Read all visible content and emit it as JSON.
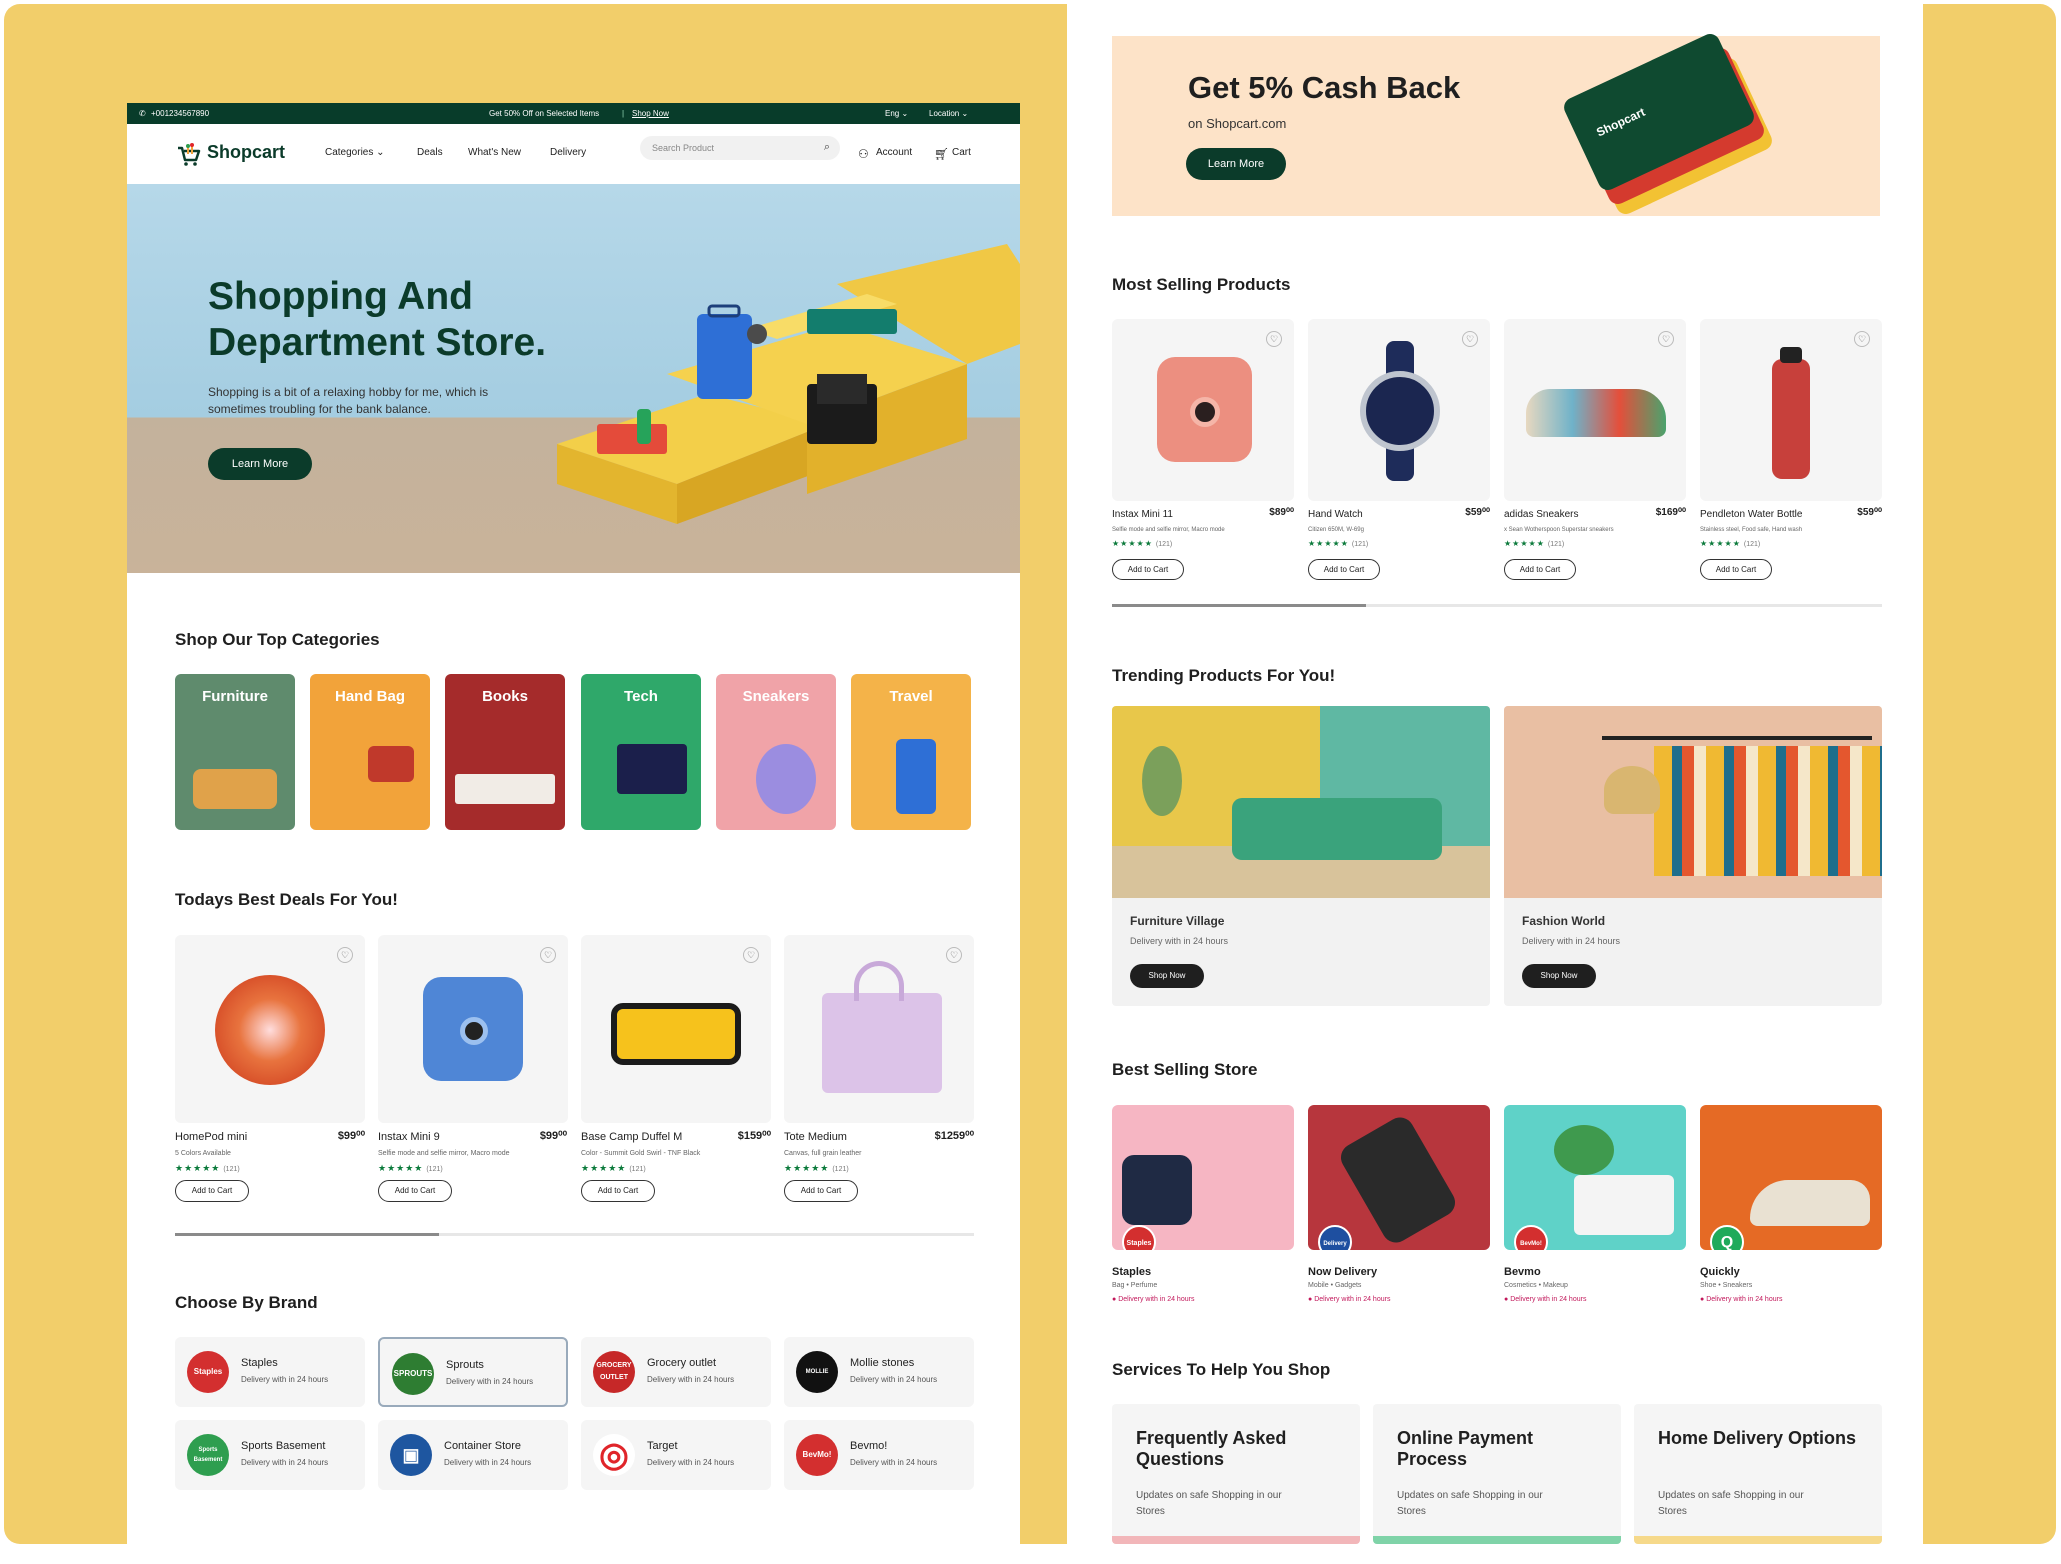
{
  "topbar": {
    "phone": "+001234567890",
    "promo": "Get 50% Off on Selected Items",
    "shop_now": "Shop Now",
    "lang": "Eng ⌄",
    "location": "Location ⌄"
  },
  "nav": {
    "logo": "Shopcart",
    "categories": "Categories ⌄",
    "deals": "Deals",
    "whats_new": "What's New",
    "delivery": "Delivery",
    "search_placeholder": "Search Product",
    "account": "Account",
    "cart": "Cart"
  },
  "hero": {
    "title": "Shopping And Department Store.",
    "subtitle": "Shopping is a bit of a relaxing hobby for me, which is sometimes troubling for the bank balance.",
    "cta": "Learn More"
  },
  "categories": {
    "title": "Shop Our Top Categories",
    "items": [
      {
        "label": "Furniture",
        "color": "#5f8b6d"
      },
      {
        "label": "Hand Bag",
        "color": "#f2a33a"
      },
      {
        "label": "Books",
        "color": "#a52b2b"
      },
      {
        "label": "Tech",
        "color": "#2fa86a"
      },
      {
        "label": "Sneakers",
        "color": "#f0a3a8"
      },
      {
        "label": "Travel",
        "color": "#f4b349"
      }
    ]
  },
  "deals": {
    "title": "Todays Best Deals For You!",
    "add_label": "Add to Cart",
    "items": [
      {
        "name": "HomePod mini",
        "price": "$99⁰⁰",
        "desc": "5 Colors Available",
        "rating": "★★★★★",
        "reviews": "(121)"
      },
      {
        "name": "Instax Mini 9",
        "price": "$99⁰⁰",
        "desc": "Selfie mode and selfie mirror, Macro mode",
        "rating": "★★★★★",
        "reviews": "(121)"
      },
      {
        "name": "Base Camp Duffel M",
        "price": "$159⁰⁰",
        "desc": "Color - Summit Gold Swirl - TNF Black",
        "rating": "★★★★★",
        "reviews": "(121)"
      },
      {
        "name": "Tote Medium",
        "price": "$1259⁰⁰",
        "desc": "Canvas, full grain leather",
        "rating": "★★★★★",
        "reviews": "(121)"
      }
    ],
    "scroll_progress": 0.33
  },
  "brands": {
    "title": "Choose By Brand",
    "items": [
      {
        "name": "Staples",
        "delivery": "Delivery with in 24 hours",
        "logo": "Staples",
        "color": "#d32f2f"
      },
      {
        "name": "Sprouts",
        "delivery": "Delivery with in 24 hours",
        "logo": "SPROUTS",
        "color": "#2e7d32"
      },
      {
        "name": "Grocery outlet",
        "delivery": "Delivery with in 24 hours",
        "logo": "GROCERY OUTLET",
        "color": "#c62828"
      },
      {
        "name": "Mollie stones",
        "delivery": "Delivery with in 24 hours",
        "logo": "MOLLIE STONE'S",
        "color": "#111111"
      },
      {
        "name": "Sports Basement",
        "delivery": "Delivery with in 24 hours",
        "logo": "Sports Basement",
        "color": "#2e9e4f"
      },
      {
        "name": "Container Store",
        "delivery": "Delivery with in 24 hours",
        "logo": "▣",
        "color": "#1e56a0"
      },
      {
        "name": "Target",
        "delivery": "Delivery with in 24 hours",
        "logo": "◎",
        "color": "#e0252a"
      },
      {
        "name": "Bevmo!",
        "delivery": "Delivery with in 24 hours",
        "logo": "BevMo!",
        "color": "#d32f2f"
      }
    ]
  },
  "promo": {
    "title": "Get 5% Cash Back",
    "subtitle": "on Shopcart.com",
    "cta": "Learn More",
    "card_brand": "Shopcart"
  },
  "most_selling": {
    "title": "Most Selling Products",
    "add_label": "Add to Cart",
    "items": [
      {
        "name": "Instax Mini 11",
        "price": "$89⁰⁰",
        "desc": "Selfie mode and selfie mirror, Macro mode",
        "rating": "★★★★★",
        "reviews": "(121)"
      },
      {
        "name": "Hand Watch",
        "price": "$59⁰⁰",
        "desc": "Citizen 650M, W-69g",
        "rating": "★★★★★",
        "reviews": "(121)"
      },
      {
        "name": "adidas Sneakers",
        "price": "$169⁰⁰",
        "desc": "x Sean Wotherspoon Superstar sneakers",
        "rating": "★★★★★",
        "reviews": "(121)"
      },
      {
        "name": "Pendleton Water Bottle",
        "price": "$59⁰⁰",
        "desc": "Stainless steel, Food safe, Hand wash",
        "rating": "★★★★★",
        "reviews": "(121)"
      }
    ],
    "scroll_progress": 0.33
  },
  "trending": {
    "title": "Trending Products For You!",
    "shop_label": "Shop Now",
    "items": [
      {
        "name": "Furniture Village",
        "delivery": "Delivery with in 24 hours"
      },
      {
        "name": "Fashion World",
        "delivery": "Delivery with in 24 hours"
      }
    ]
  },
  "stores": {
    "title": "Best Selling Store",
    "items": [
      {
        "name": "Staples",
        "cats": "Bag • Perfume",
        "delivery": "Delivery with in 24 hours",
        "badge": "Staples",
        "badge_color": "#d32f2f",
        "bg": "#f6b6c3"
      },
      {
        "name": "Now Delivery",
        "cats": "Mobile • Gadgets",
        "delivery": "Delivery with in 24 hours",
        "badge": "Delivery",
        "badge_color": "#1e4fa0",
        "bg": "#b7363d"
      },
      {
        "name": "Bevmo",
        "cats": "Cosmetics • Makeup",
        "delivery": "Delivery with in 24 hours",
        "badge": "BevMo!",
        "badge_color": "#d32f2f",
        "bg": "#5fd2c8"
      },
      {
        "name": "Quickly",
        "cats": "Shoe • Sneakers",
        "delivery": "Delivery with in 24 hours",
        "badge": "Q",
        "badge_color": "#1faa5b",
        "bg": "#e56a25"
      }
    ]
  },
  "services": {
    "title": "Services To Help You Shop",
    "items": [
      {
        "title": "Frequently Asked Questions",
        "desc": "Updates on safe Shopping in our Stores",
        "color": "#f2b6b9"
      },
      {
        "title": "Online Payment Process",
        "desc": "Updates on safe Shopping in our Stores",
        "color": "#7fd3a8"
      },
      {
        "title": "Home Delivery Options",
        "desc": "Updates on safe Shopping in our Stores",
        "color": "#f6d98a"
      }
    ]
  }
}
